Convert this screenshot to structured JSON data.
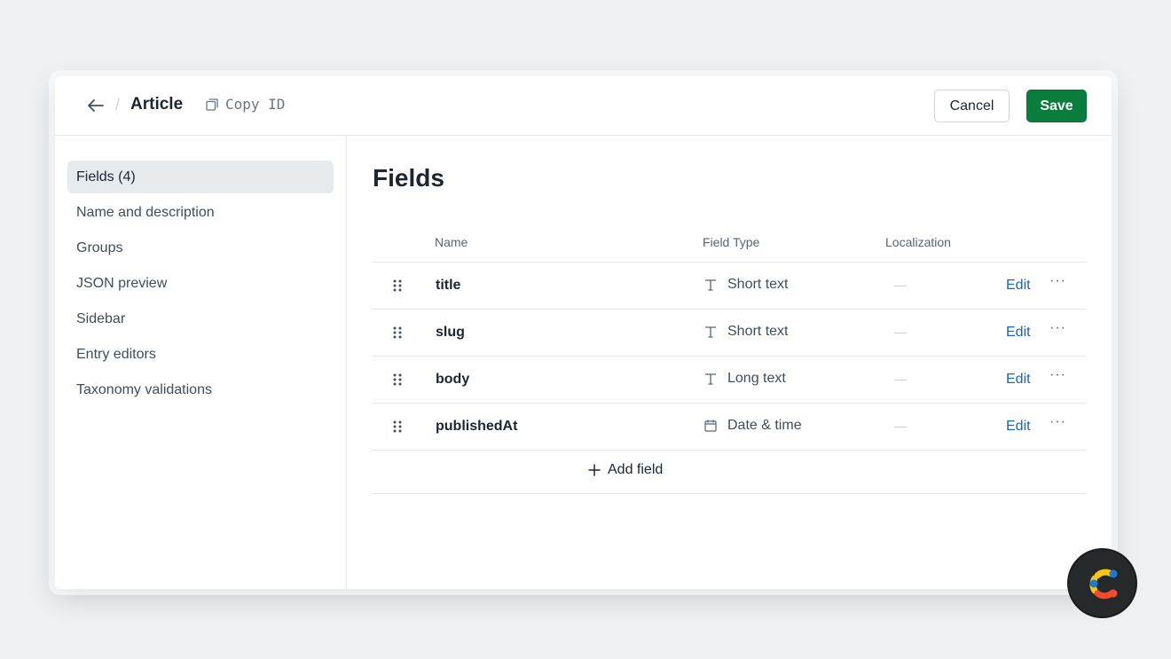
{
  "header": {
    "title": "Article",
    "copy_id_label": "Copy ID",
    "cancel_label": "Cancel",
    "save_label": "Save"
  },
  "sidebar": {
    "items": [
      {
        "label": "Fields (4)",
        "active": true
      },
      {
        "label": "Name and description"
      },
      {
        "label": "Groups"
      },
      {
        "label": "JSON preview"
      },
      {
        "label": "Sidebar"
      },
      {
        "label": "Entry editors"
      },
      {
        "label": "Taxonomy validations"
      }
    ]
  },
  "main": {
    "heading": "Fields",
    "columns": {
      "name": "Name",
      "field_type": "Field Type",
      "localization": "Localization"
    },
    "rows": [
      {
        "name": "title",
        "type": "Short text",
        "type_icon": "text-icon",
        "localization": "—",
        "edit_label": "Edit",
        "more": "···"
      },
      {
        "name": "slug",
        "type": "Short text",
        "type_icon": "text-icon",
        "localization": "—",
        "edit_label": "Edit",
        "more": "···"
      },
      {
        "name": "body",
        "type": "Long text",
        "type_icon": "text-icon",
        "localization": "—",
        "edit_label": "Edit",
        "more": "···"
      },
      {
        "name": "publishedAt",
        "type": "Date & time",
        "type_icon": "calendar-icon",
        "localization": "—",
        "edit_label": "Edit",
        "more": "···"
      }
    ],
    "add_field_label": "Add field"
  },
  "colors": {
    "save_bg": "#0a7c3e",
    "link": "#1565c0",
    "active_nav_bg": "#e8ebee",
    "page_bg": "#eef1f3"
  }
}
